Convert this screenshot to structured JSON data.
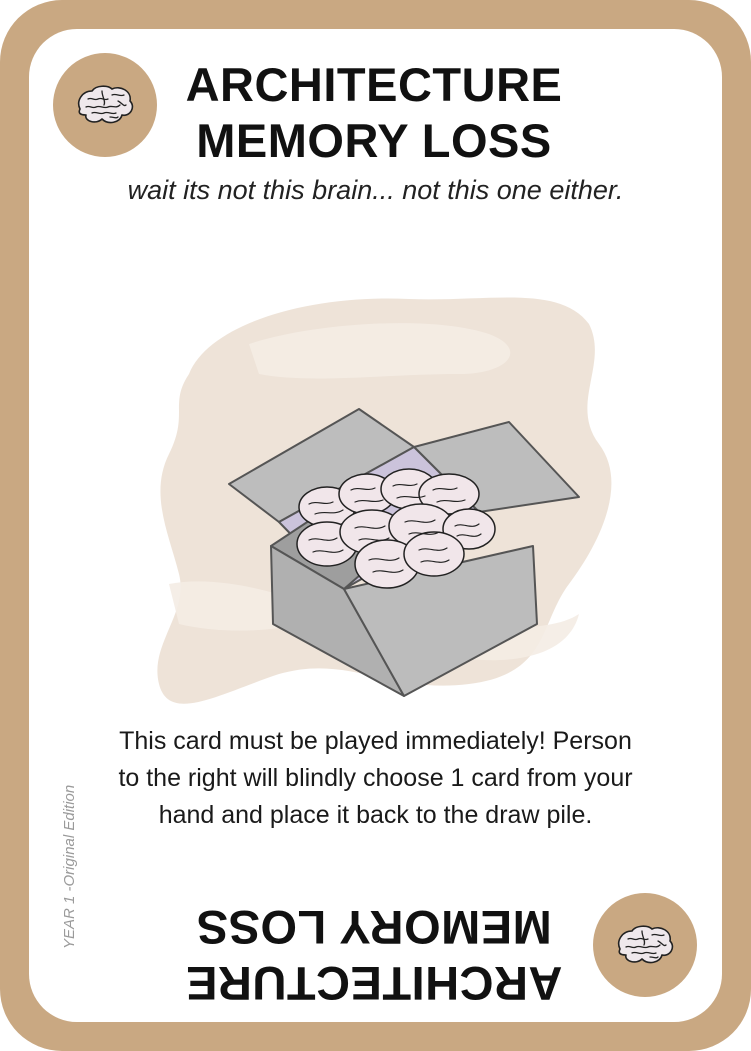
{
  "card": {
    "title_line1": "ARCHITECTURE",
    "title_line2": "MEMORY LOSS",
    "subtitle": "wait its not this brain... not this one either.",
    "body_line1": "This card must be played immediately! Person",
    "body_line2": "to the right will blindly choose 1 card from your",
    "body_line3": "hand and place it back to the draw pile.",
    "edition": "YEAR 1 -Original Edition",
    "badge_icon": "brain-icon",
    "illustration_icon": "box-of-brains-icon"
  },
  "colors": {
    "border": "#c9a882",
    "badge": "#c9a882",
    "splash": "#e8d9cb",
    "box": "#b4b4b4",
    "box_inner": "#c8c0d8",
    "brain": "#f1e6ea"
  }
}
